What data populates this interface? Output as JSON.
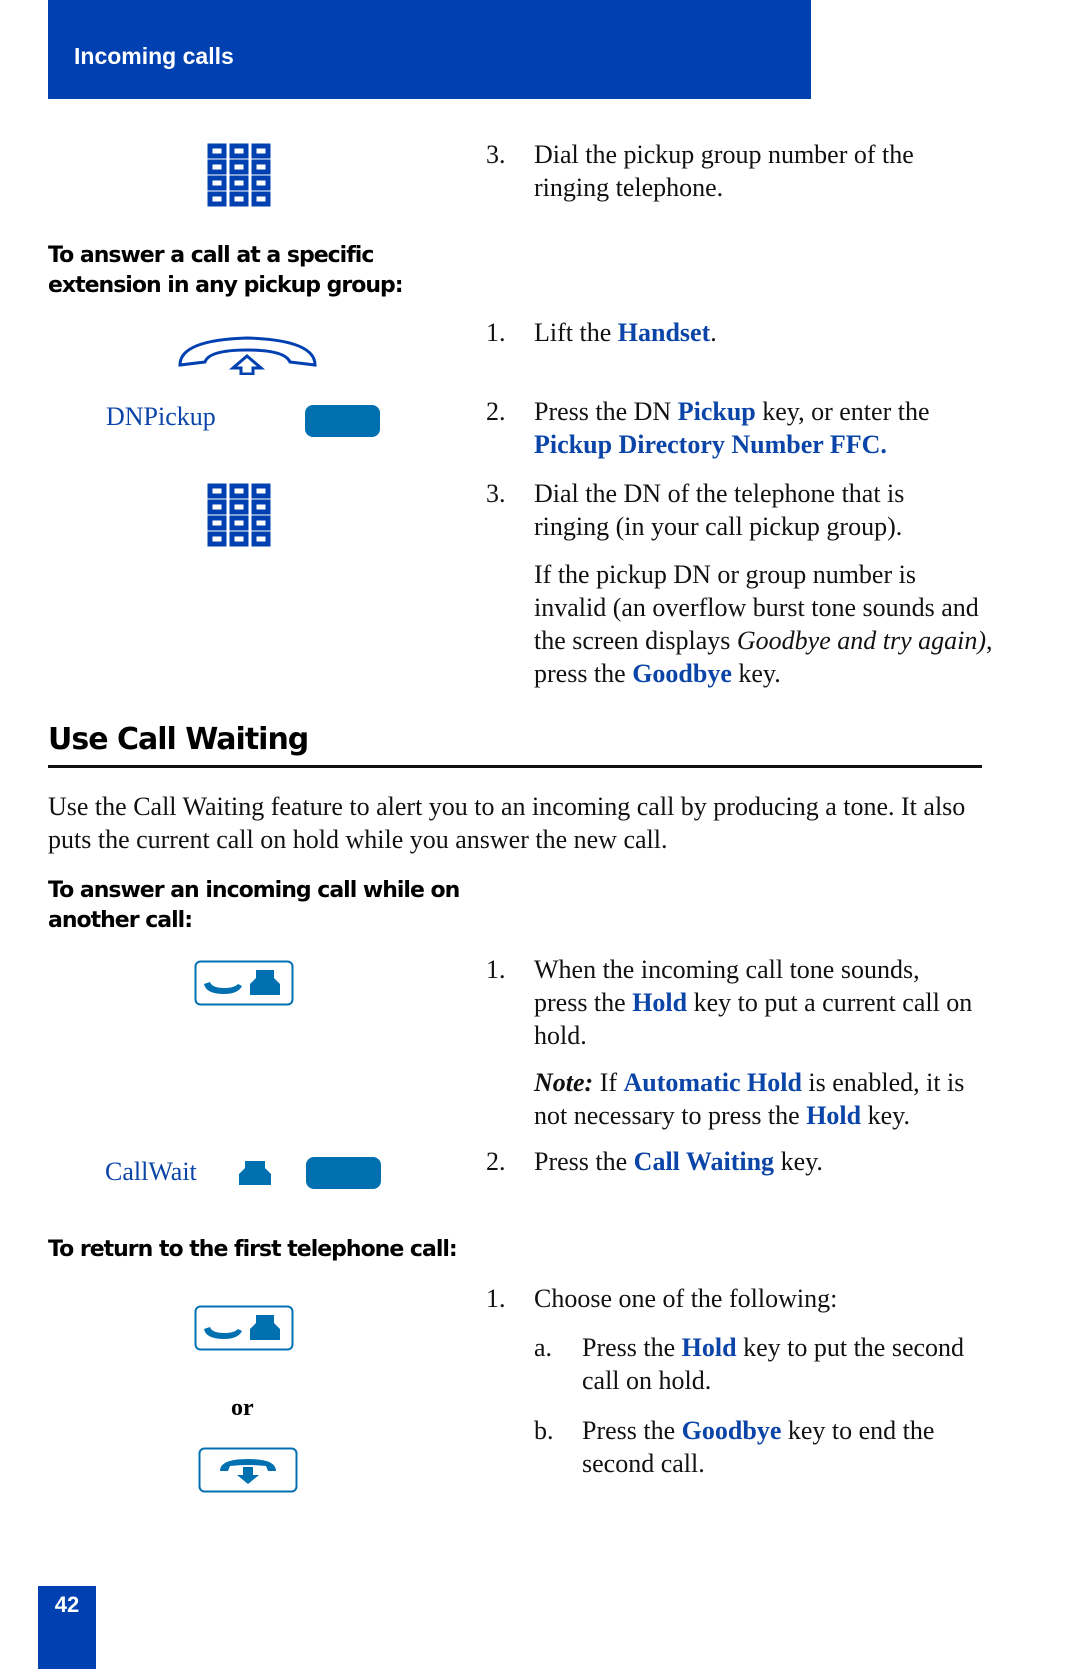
{
  "header": {
    "title": "Incoming calls"
  },
  "page_number": "42",
  "section1": {
    "step3_top": {
      "num": "3.",
      "text": "Dial the pickup group number of the ringing telephone."
    },
    "subhead": "To answer a call at a specific extension in any pickup group:",
    "steps": [
      {
        "num": "1.",
        "pre": "Lift the ",
        "kw": "Handset",
        "post": "."
      },
      {
        "num": "2.",
        "pre": "Press the DN ",
        "kw": "Pickup",
        "mid": " key, or enter the ",
        "kw2": "Pickup Directory Number FFC."
      },
      {
        "num": "3.",
        "text": "Dial the DN of the telephone that is ringing (in your call pickup group)."
      }
    ],
    "note": {
      "pre": "If the pickup DN or group number is invalid (an overflow burst tone sounds and the screen displays ",
      "italic": "Goodbye and try again)",
      "mid": ", press the ",
      "kw": "Goodbye",
      "post": " key."
    },
    "dnpickup_label": "DNPickup"
  },
  "section2": {
    "title": "Use Call Waiting",
    "intro": "Use the Call Waiting feature to alert you to an incoming call by producing a tone. It also puts the current call on hold while you answer the new call.",
    "subhead1": "To answer an incoming call while on another call:",
    "steps1": [
      {
        "num": "1.",
        "pre": "When the incoming call tone sounds, press the ",
        "kw": "Hold",
        "post": " key to put a current call on hold."
      },
      {
        "num": "2.",
        "pre": "Press the ",
        "kw": "Call Waiting",
        "post": " key."
      }
    ],
    "note": {
      "label": "Note:",
      "pre": " If ",
      "kw": "Automatic Hold",
      "mid": " is enabled, it is not necessary to press the ",
      "kw2": "Hold",
      "post": " key."
    },
    "callwait_label": "CallWait",
    "subhead2": "To return to the first telephone call:",
    "steps2": {
      "num": "1.",
      "text": "Choose one of the following:",
      "options": [
        {
          "letter": "a.",
          "pre": "Press the ",
          "kw": "Hold",
          "post": " key to put the second call on hold."
        },
        {
          "letter": "b.",
          "pre": "Press the ",
          "kw": "Goodbye",
          "post": " key to end the second call."
        }
      ]
    },
    "or_label": "or"
  }
}
